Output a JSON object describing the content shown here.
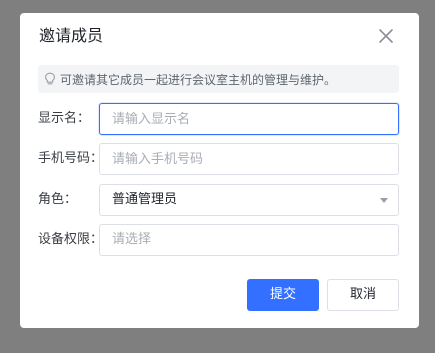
{
  "dialog": {
    "title": "邀请成员",
    "close_icon": "close-icon",
    "tip": {
      "icon": "lightbulb-icon",
      "text": "可邀请其它成员一起进行会议室主机的管理与维护。"
    },
    "fields": {
      "display_name": {
        "label": "显示名：",
        "placeholder": "请输入显示名",
        "value": ""
      },
      "phone": {
        "label": "手机号码：",
        "placeholder": "请输入手机号码",
        "value": ""
      },
      "role": {
        "label": "角色：",
        "value": "普通管理员"
      },
      "device_permission": {
        "label": "设备权限：",
        "placeholder": "请选择",
        "value": ""
      }
    },
    "buttons": {
      "submit": "提交",
      "cancel": "取消"
    }
  },
  "colors": {
    "primary": "#3370ff",
    "overlay": "#7f7f7f",
    "tip_background": "#f3f4f6",
    "border": "#dcdfe6"
  }
}
